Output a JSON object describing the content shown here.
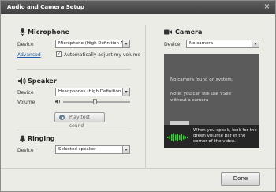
{
  "window": {
    "title": "Audio and Camera Setup",
    "close_glyph": "×"
  },
  "microphone": {
    "title": "Microphone",
    "icon": "microphone-icon",
    "device_label": "Device",
    "device_value": "Microphone (High Definition Au",
    "advanced_link": "Advanced",
    "auto_adjust_label": "Automatically adjust my volume",
    "auto_adjust_checked": true
  },
  "speaker": {
    "title": "Speaker",
    "icon": "speaker-icon",
    "device_label": "Device",
    "device_value": "Headphones (High Definition Au",
    "volume_label": "Volume",
    "volume_level": 0.48,
    "test_button": "Play test sound"
  },
  "ringing": {
    "title": "Ringing",
    "icon": "bell-icon",
    "device_label": "Device",
    "device_value": "Selected speaker"
  },
  "camera": {
    "title": "Camera",
    "icon": "video-camera-icon",
    "device_label": "Device",
    "device_value": "No camera",
    "preview_message": "No camera found on system.",
    "preview_note_line1": "Note: you can still use VSee",
    "preview_note_line2": "without a camera",
    "tip_text": "When you speak, look for the green volume bar in the corner of the video."
  },
  "footer": {
    "done_button": "Done"
  },
  "colors": {
    "accent_link": "#1e5ca8",
    "volume_bar": "#33d633",
    "titlebar": "#4a4a4a"
  }
}
